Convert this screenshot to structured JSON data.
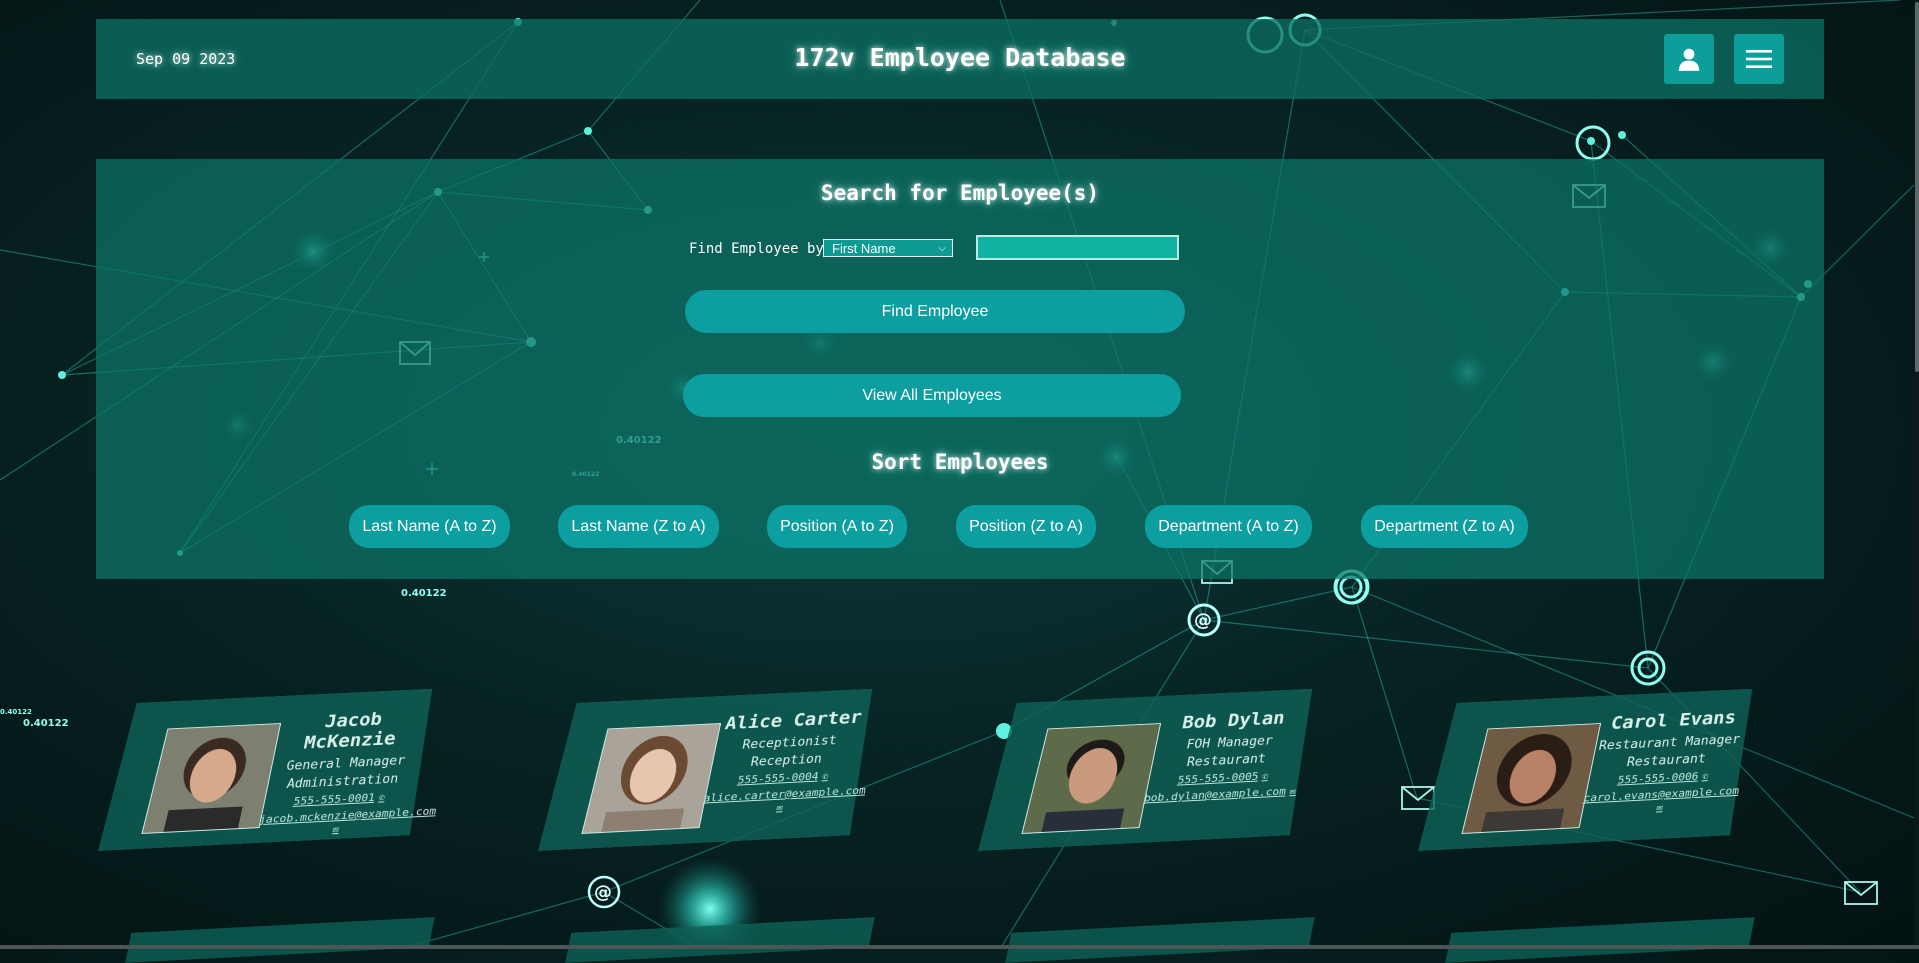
{
  "header": {
    "date": "Sep 09 2023",
    "title": "172v Employee Database",
    "user_icon": "user-icon",
    "menu_icon": "hamburger-menu-icon"
  },
  "search": {
    "heading": "Search for Employee(s)",
    "find_label": "Find Employee by",
    "select_value": "First Name",
    "input_value": "",
    "find_button": "Find Employee",
    "view_all_button": "View All Employees"
  },
  "sort": {
    "heading": "Sort Employees",
    "buttons": [
      "Last Name (A to Z)",
      "Last Name (Z to A)",
      "Position (A to Z)",
      "Position (Z to A)",
      "Department (A to Z)",
      "Department (Z to A)"
    ]
  },
  "employees": [
    {
      "name": "Jacob McKenzie",
      "position": "General Manager",
      "department": "Administration",
      "phone": "555-555-0001",
      "email": "jacob.mckenzie@example.com"
    },
    {
      "name": "Alice Carter",
      "position": "Receptionist",
      "department": "Reception",
      "phone": "555-555-0004",
      "email": "alice.carter@example.com"
    },
    {
      "name": "Bob Dylan",
      "position": "FOH Manager",
      "department": "Restaurant",
      "phone": "555-555-0005",
      "email": "bob.dylan@example.com"
    },
    {
      "name": "Carol Evans",
      "position": "Restaurant Manager",
      "department": "Restaurant",
      "phone": "555-555-0006",
      "email": "carol.evans@example.com"
    }
  ],
  "background_labels": [
    "0.40122",
    "0.40122",
    "0.40122",
    "0.40122"
  ],
  "colors": {
    "panel": "#0b6e62",
    "button": "#0d9ea0",
    "input": "#13b1a2",
    "background": "#031212"
  }
}
